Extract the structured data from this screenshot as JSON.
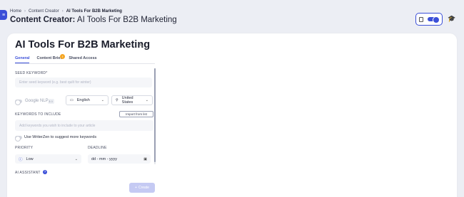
{
  "breadcrumb": {
    "home": "Home",
    "parent": "Content Creator",
    "current": "AI Tools For B2B Marketing"
  },
  "header": {
    "title_prefix": "Content Creator:",
    "title_rest": " AI Tools For B2B Marketing"
  },
  "doc": {
    "title": "AI Tools For B2B Marketing"
  },
  "tabs": [
    {
      "label": "General",
      "active": true
    },
    {
      "label": "Content Brief"
    },
    {
      "label": "Shared Access"
    }
  ],
  "form": {
    "seed_keyword_label": "SEED KEYWORD*",
    "seed_keyword_placeholder": "Enter seed keyword (e.g. best quilt for winter)",
    "google_nlp_label": "Google NLP",
    "google_nlp_badge": "ℹ 0",
    "language": "English",
    "location": "United States",
    "keywords_label": "KEYWORDS TO INCLUDE",
    "import_label": "Import from list",
    "keywords_placeholder": "Add keywords you wish to include to your article",
    "writerzen_label": "Use WriterZen to suggest more keywords",
    "priority_label": "PRIORITY",
    "priority_value": "Low",
    "deadline_label": "DEADLINE",
    "deadline_value": "dd - mm - yyyy",
    "ai_assistant_label": "AI ASSISTANT",
    "create_label": "Create"
  },
  "icons": {
    "menu": "menu-icon",
    "edit": "pencil-icon",
    "flag": "flag-icon",
    "pin": "pin-icon",
    "priority": "info-icon",
    "calendar": "calendar-icon",
    "help": "question-icon",
    "hat": "graduation-cap-icon"
  },
  "colors": {
    "accent": "#3b4fd8",
    "badge": "#f5a623",
    "create_disabled": "#c5caf3"
  }
}
